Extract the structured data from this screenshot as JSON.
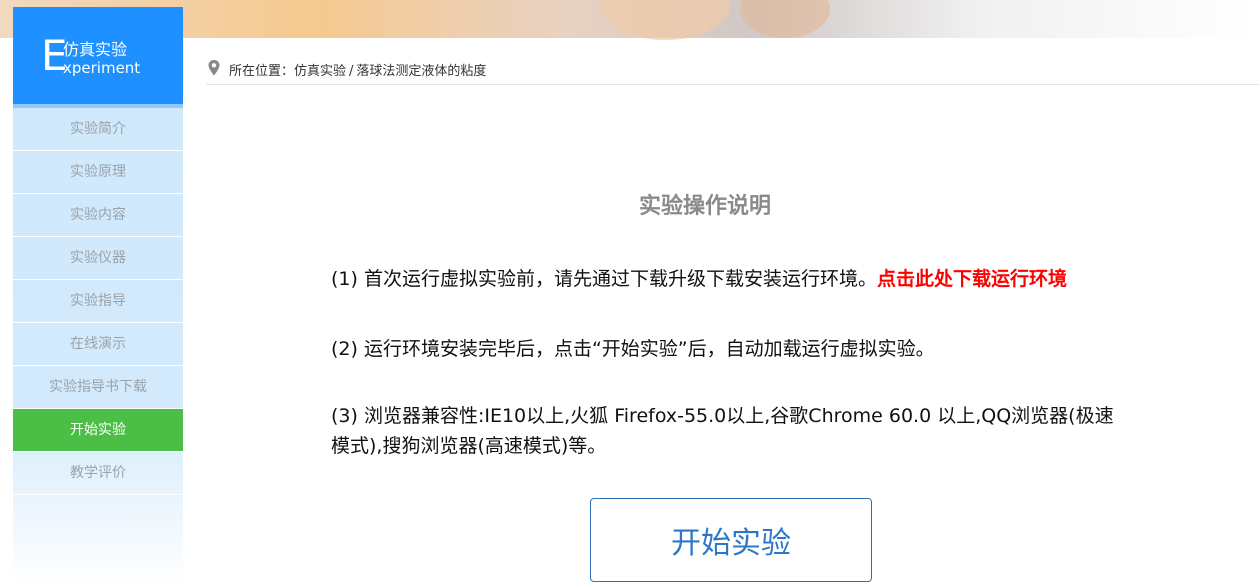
{
  "logo": {
    "letter": "E",
    "cn": "仿真实验",
    "en": "xperiment"
  },
  "nav": {
    "items": [
      {
        "label": "实验简介"
      },
      {
        "label": "实验原理"
      },
      {
        "label": "实验内容"
      },
      {
        "label": "实验仪器"
      },
      {
        "label": "实验指导"
      },
      {
        "label": "在线演示"
      },
      {
        "label": "实验指导书下载"
      },
      {
        "label": "开始实验",
        "active": true
      },
      {
        "label": "教学评价"
      }
    ]
  },
  "breadcrumb": {
    "prefix": "所在位置：",
    "parent": "仿真实验",
    "separator": "/",
    "current": "落球法测定液体的粘度"
  },
  "content": {
    "title": "实验操作说明",
    "p1_text": "(1) 首次运行虚拟实验前，请先通过下载升级下载安装运行环境。",
    "p1_link": "点击此处下载运行环境",
    "p2_text": "(2) 运行环境安装完毕后，点击“开始实验”后，自动加载运行虚拟实验。",
    "p3_text": "(3) 浏览器兼容性:IE10以上,火狐 Firefox-55.0以上,谷歌Chrome 60.0 以上,QQ浏览器(极速模式),搜狗浏览器(高速模式)等。",
    "start_button": "开始实验"
  },
  "colors": {
    "accent_blue": "#1e90ff",
    "active_green": "#4bbf45",
    "link_red": "#ff0000",
    "button_text": "#2d77c8"
  },
  "icons": {
    "breadcrumb": "location-pin-icon"
  }
}
